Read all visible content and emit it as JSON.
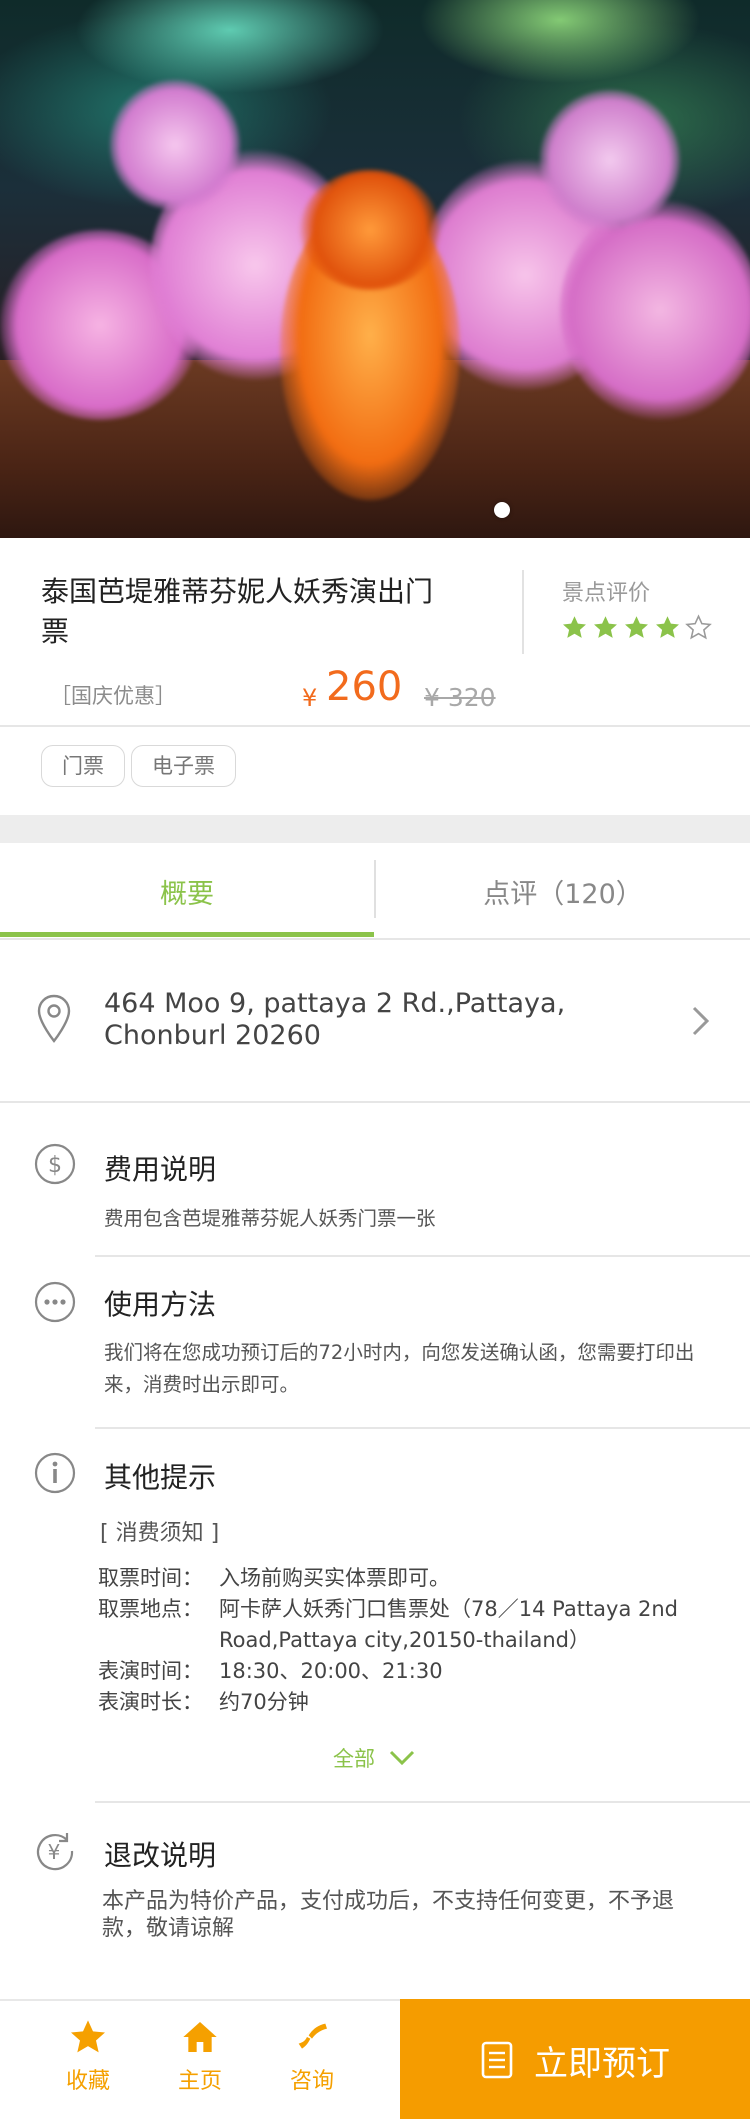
{
  "hero": {
    "carousel_dots": 1,
    "active_dot": 1
  },
  "product": {
    "title": "泰国芭堤雅蒂芬妮人妖秀演出门票",
    "promo_tag": "［国庆优惠］",
    "price_symbol": "¥",
    "price": "260",
    "original_price": "¥ 320",
    "rating_label": "景点评价",
    "rating": 4,
    "rating_max": 5
  },
  "tags": [
    "门票",
    "电子票"
  ],
  "tabs": {
    "overview": "概要",
    "reviews": "点评（120）",
    "active": "overview"
  },
  "address": "464 Moo 9, pattaya 2 Rd.,Pattaya, Chonburl  20260",
  "sections": {
    "fee": {
      "title": "费用说明",
      "body": "费用包含芭堤雅蒂芬妮人妖秀门票一张",
      "icon": "dollar-circle-icon"
    },
    "usage": {
      "title": "使用方法",
      "body": "我们将在您成功预订后的72小时内，向您发送确认函，您需要打印出来，消费时出示即可。",
      "icon": "ellipsis-circle-icon"
    },
    "tips": {
      "title": "其他提示",
      "icon": "info-circle-icon",
      "notice_heading": "[ 消费须知 ]",
      "rows": [
        {
          "key": "取票时间：",
          "value": "入场前购买实体票即可。"
        },
        {
          "key": "取票地点：",
          "value": "阿卡萨人妖秀门口售票处（78／14 Pattaya 2nd Road,Pattaya city,20150-thailand）"
        },
        {
          "key": "表演时间：",
          "value": "18:30、20:00、21:30"
        },
        {
          "key": "表演时长：",
          "value": "约70分钟"
        }
      ],
      "more_label": "全部"
    },
    "refund": {
      "title": "退改说明",
      "body": "本产品为特价产品，支付成功后，不支持任何变更，不予退款，敬请谅解",
      "icon": "yen-refresh-icon"
    }
  },
  "bottom_bar": {
    "favorite": "收藏",
    "home": "主页",
    "consult": "咨询",
    "book": "立即预订"
  },
  "colors": {
    "accent_green": "#8bc34a",
    "price_orange": "#f26b1d",
    "book_orange": "#f59c00"
  }
}
